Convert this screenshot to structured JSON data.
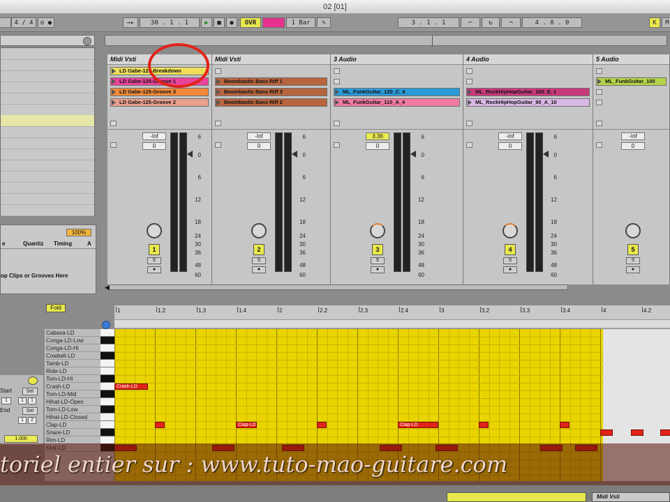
{
  "window": {
    "title": "02  [01]"
  },
  "controlbar": {
    "time_sig": "4 / 4",
    "position": "30 .   1 .   1",
    "ovr": "OVR",
    "quantize": "1 Bar",
    "loop_start": "3 .   1 .   1",
    "loop_length": "4 .   0 .   0"
  },
  "groove": {
    "percent": "100%",
    "col_quantize": "Quantiz",
    "col_timing": "Timing",
    "col_a": "A",
    "col_left": "e",
    "hint": "op Clips or Grooves Here"
  },
  "tracks": [
    {
      "name": "Midi Vsti",
      "num": "1",
      "vol_top": "-Inf",
      "vol_val": "0",
      "highlight": false,
      "clips": [
        {
          "name": "LD Gabe-125-Breakdown",
          "color": "#eede5a"
        },
        {
          "name": "LD Gabe-125-Groove 1",
          "color": "#e8449a"
        },
        {
          "name": "LD Gabe-125-Groove 3",
          "color": "#f08a3a"
        },
        {
          "name": "LD Gabe-125-Groove 2",
          "color": "#e9a08e"
        }
      ]
    },
    {
      "name": "Midi Vsti",
      "num": "2",
      "vol_top": "-Inf",
      "vol_val": "0",
      "highlight": false,
      "clips": [
        {
          "name": "",
          "color": ""
        },
        {
          "name": "Boombastic Bass Riff 1",
          "color": "#b7653e"
        },
        {
          "name": "Boombastic Bass Riff 3",
          "color": "#b7653e"
        },
        {
          "name": "Boombastic Bass Riff 2",
          "color": "#b7653e"
        }
      ]
    },
    {
      "name": "3 Audio",
      "num": "3",
      "vol_top": "3.36",
      "vol_val": "0",
      "highlight": true,
      "clips": [
        {
          "name": "",
          "color": ""
        },
        {
          "name": "",
          "color": ""
        },
        {
          "name": "ML_FunkGuitar_120_C_6",
          "color": "#2c9ad6"
        },
        {
          "name": "ML_FunkGuitar_110_A_4",
          "color": "#f07aa0"
        }
      ]
    },
    {
      "name": "4 Audio",
      "num": "4",
      "vol_top": "-Inf",
      "vol_val": "0",
      "highlight": false,
      "clips": [
        {
          "name": "",
          "color": ""
        },
        {
          "name": "",
          "color": ""
        },
        {
          "name": "ML_RockHipHopGuitar_100_E_1",
          "color": "#c83a7c"
        },
        {
          "name": "ML_RockHipHopGuitar_90_A_10",
          "color": "#d9b8e6"
        }
      ]
    },
    {
      "name": "5 Audio",
      "num": "5",
      "vol_top": "-Inf",
      "vol_val": "0",
      "highlight": false,
      "clips": [
        {
          "name": "",
          "color": ""
        },
        {
          "name": "ML_FunkGuitar_100",
          "color": "#b4d34a"
        },
        {
          "name": "",
          "color": ""
        },
        {
          "name": "",
          "color": ""
        }
      ]
    }
  ],
  "meter_scale": [
    "6",
    "0",
    "6",
    "12",
    "18",
    "24",
    "30",
    "36",
    "48",
    "60"
  ],
  "solo_label": "S",
  "midi": {
    "fold": "Fold",
    "ruler": [
      "1",
      "1.2",
      "1.3",
      "1.4",
      "2",
      "2.2",
      "2.3",
      "2.4",
      "3",
      "3.2",
      "3.3",
      "3.4",
      "4",
      "4.2"
    ],
    "keys": [
      "Cabasa-LD",
      "Conga-LD-Low",
      "Conga-LD-Hi",
      "Cowbell-LD",
      "Tamb-LD",
      "Ride-LD",
      "Tom-LD-Hi",
      "Crash-LD",
      "Tom-LD-Mid",
      "Hihat-LD-Open",
      "Tom-LD-Low",
      "Hihat-LD-Closed",
      "Clap-LD",
      "Snare-LD",
      "Rim-LD",
      "Kick-LD"
    ],
    "notes_crash": "Crash-LD",
    "notes_clap": [
      "Clap-LD",
      "Clap-LD"
    ],
    "left": {
      "start": "Start",
      "set": "Set",
      "end": "End",
      "v1": "1",
      "v2": "2",
      "val": "1.000"
    }
  },
  "watermark": "toriel entier sur : www.tuto-mao-guitare.com",
  "bottom": {
    "track_label": "Midi Vsti"
  }
}
